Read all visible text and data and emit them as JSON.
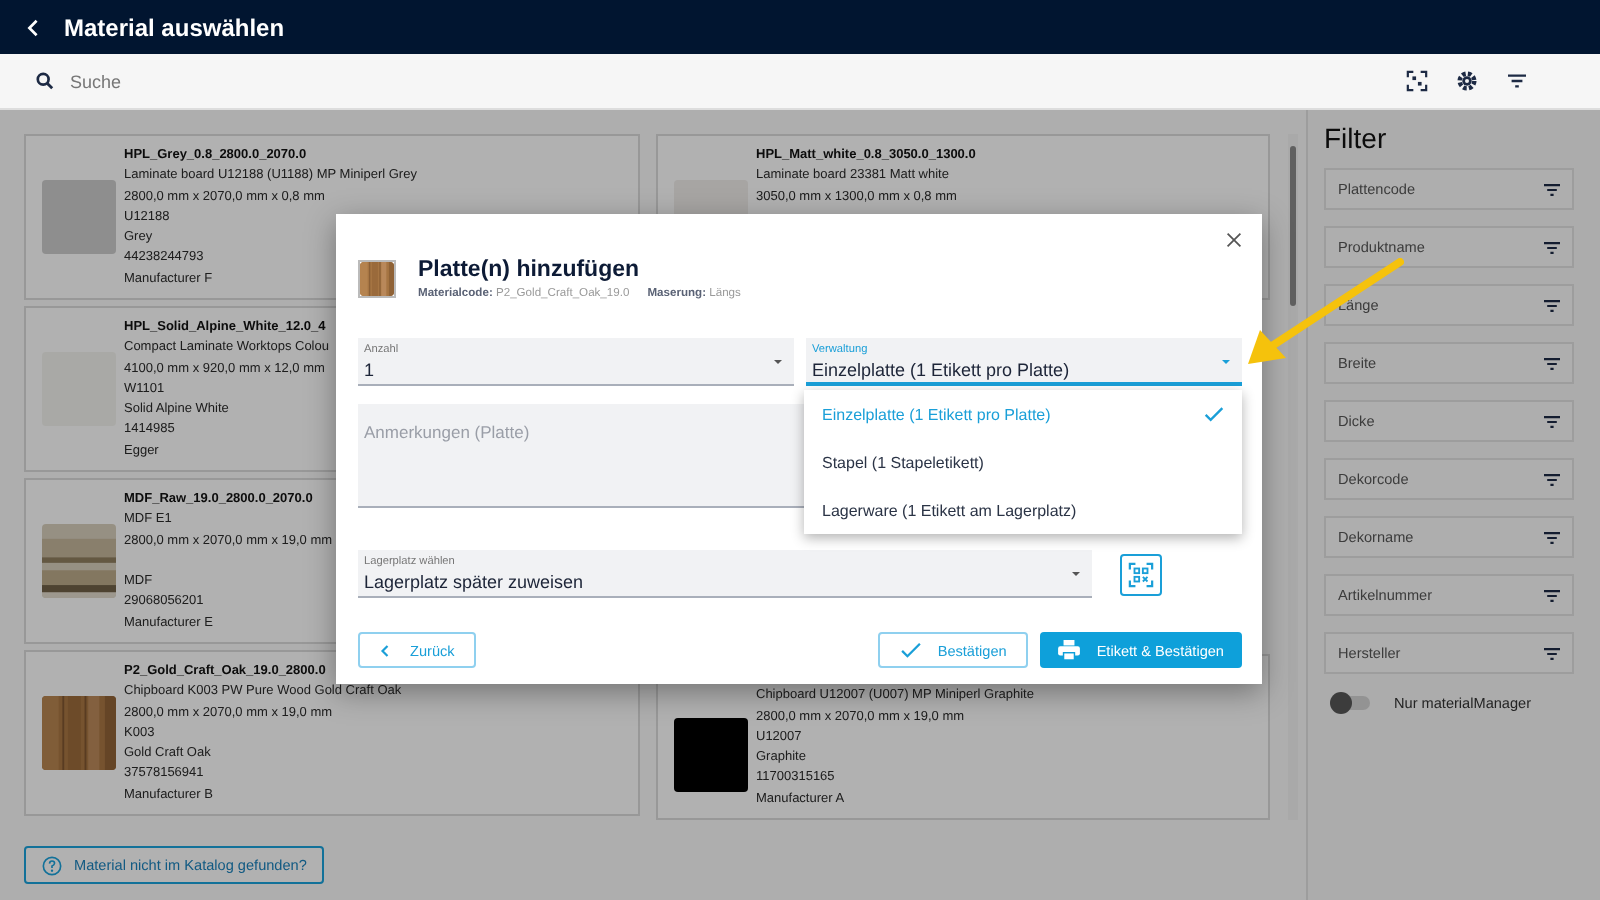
{
  "header": {
    "title": "Material auswählen"
  },
  "search": {
    "placeholder": "Suche"
  },
  "card_columns": [
    {
      "cards": [
        {
          "title": "HPL_Grey_0.8_2800.0_2070.0",
          "description": "Laminate board U12188 (U1188) MP Miniperl Grey",
          "dimensions": "2800,0 mm x 2070,0 mm x 0,8 mm",
          "decor_code": "U12188",
          "decor_name": "Grey",
          "article_number": "44238244793",
          "manufacturer": "Manufacturer F",
          "thumb": {
            "kind": "swatch",
            "color": "#8e8e8e"
          }
        },
        {
          "title": "HPL_Solid_Alpine_White_12.0_4",
          "description": "Compact Laminate Worktops Colou",
          "dimensions": "4100,0 mm x 920,0 mm x 12,0 mm",
          "decor_code": "W1101",
          "decor_name": "Solid Alpine White",
          "article_number": "1414985",
          "manufacturer": "Egger",
          "thumb": {
            "kind": "swatch",
            "color": "#a9a9a6"
          }
        },
        {
          "title": "MDF_Raw_19.0_2800.0_2070.0",
          "description": "MDF E1",
          "dimensions": "2800,0 mm x 2070,0 mm x 19,0 mm",
          "decor_name": "MDF",
          "article_number": "29068056201",
          "manufacturer": "Manufacturer E"
        },
        {
          "title": "P2_Gold_Craft_Oak_19.0_2800.0",
          "description": "Chipboard K003 PW Pure Wood Gold Craft Oak",
          "dimensions": "2800,0 mm x 2070,0 mm x 19,0 mm",
          "decor_code": "K003",
          "decor_name": "Gold Craft Oak",
          "article_number": "37578156941",
          "manufacturer": "Manufacturer B"
        }
      ]
    },
    {
      "cards": [
        {
          "title": "HPL_Matt_white_0.8_3050.0_1300.0",
          "description": "Laminate board 23381 Matt white",
          "dimensions": "3050,0 mm x 1300,0 mm x 0,8 mm",
          "thumb": {
            "kind": "swatch",
            "color": "#a7a5a3"
          }
        },
        {
          "description": "Chipboard U12007 (U007) MP Miniperl Graphite",
          "dimensions": "2800,0 mm x 2070,0 mm x 19,0 mm",
          "decor_code": "U12007",
          "decor_name": "Graphite",
          "article_number": "11700315165",
          "manufacturer": "Manufacturer A",
          "thumb": {
            "kind": "swatch",
            "color": "#000000"
          }
        }
      ]
    }
  ],
  "help_button": "Material nicht im Katalog gefunden?",
  "filter": {
    "title": "Filter",
    "fields": [
      "Plattencode",
      "Produktname",
      "Länge",
      "Breite",
      "Dicke",
      "Dekorcode",
      "Dekorname",
      "Artikelnummer",
      "Hersteller"
    ],
    "toggle": {
      "label": "Nur materialManager",
      "on": false
    }
  },
  "modal": {
    "title": "Platte(n) hinzufügen",
    "material_code": "**Materialcode:** P2_Gold_Craft_Oak_19.0",
    "grain": "**Maserung:** Längs",
    "quantity": {
      "label": "Anzahl",
      "value": "1"
    },
    "management": {
      "label": "Verwaltung",
      "value": "Einzelplatte (1 Etikett pro Platte)",
      "expanded": true,
      "options": [
        {
          "label": "Einzelplatte (1 Etikett pro Platte)",
          "selected": true
        },
        {
          "label": "Stapel (1 Stapeletikett)",
          "selected": false
        },
        {
          "label": "Lagerware (1 Etikett am Lagerplatz)",
          "selected": false
        }
      ]
    },
    "notes": {
      "placeholder": "Anmerkungen (Platte)"
    },
    "storage": {
      "label": "Lagerplatz wählen",
      "value": "Lagerplatz später zuweisen"
    },
    "buttons": {
      "back": "Zurück",
      "confirm": "Bestätigen",
      "label_confirm": "Etikett & Bestätigen"
    }
  }
}
